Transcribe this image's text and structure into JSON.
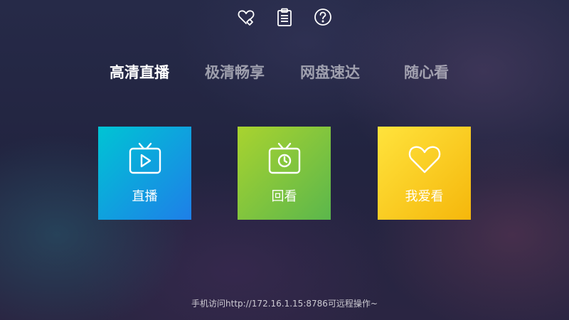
{
  "top_bar": {
    "icons": [
      "favorite-tag-icon",
      "clipboard-icon",
      "help-icon"
    ]
  },
  "tabs": [
    {
      "label": "高清直播",
      "active": true
    },
    {
      "label": "极清畅享",
      "active": false
    },
    {
      "label": "网盘速达",
      "active": false
    },
    {
      "label": "随心看",
      "active": false
    }
  ],
  "tiles": [
    {
      "label": "直播",
      "icon": "tv-play-icon",
      "gradient_start": "#00c2d6",
      "gradient_end": "#1f7fe8"
    },
    {
      "label": "回看",
      "icon": "tv-clock-icon",
      "gradient_start": "#a8d12e",
      "gradient_end": "#5db84a"
    },
    {
      "label": "我爱看",
      "icon": "heart-icon",
      "gradient_start": "#ffe23a",
      "gradient_end": "#f6b80c"
    }
  ],
  "footer": {
    "text": "手机访问http://172.16.1.15:8786可远程操作~"
  }
}
